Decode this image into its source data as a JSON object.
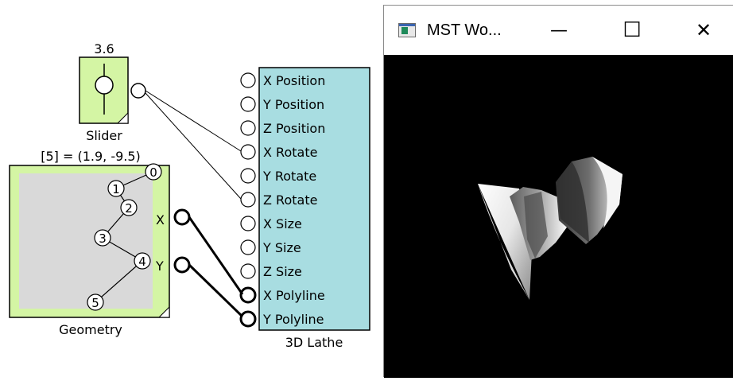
{
  "slider": {
    "value": "3.6",
    "caption": "Slider"
  },
  "geometry": {
    "readout": "[5] = (1.9, -9.5)",
    "caption": "Geometry",
    "points": [
      "0",
      "1",
      "2",
      "3",
      "4",
      "5"
    ],
    "outputs": {
      "x": "X",
      "y": "Y"
    }
  },
  "lathe": {
    "caption": "3D Lathe",
    "inputs": [
      "X Position",
      "Y Position",
      "Z Position",
      "X Rotate",
      "Y Rotate",
      "Z Rotate",
      "X Size",
      "Y Size",
      "Z Size",
      "X Polyline",
      "Y Polyline"
    ]
  },
  "window": {
    "title": "MST Wo...",
    "minimize": "—",
    "maximize": "☐",
    "close": "✕"
  },
  "colors": {
    "slider_body": "#d4f5a4",
    "geometry_body": "#d4f5a4",
    "geometry_plot": "#d9d9d9",
    "lathe_body": "#a8dde1",
    "viewport": "#000000"
  }
}
